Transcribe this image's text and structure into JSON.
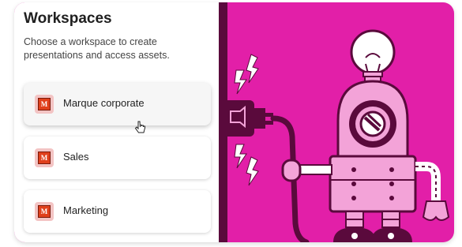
{
  "panel": {
    "title": "Workspaces",
    "subtitle": "Choose a workspace to create presentations and access assets."
  },
  "workspaces": [
    {
      "name": "Marque corporate",
      "logo_letter": "M",
      "selected": true
    },
    {
      "name": "Sales",
      "logo_letter": "M",
      "selected": false
    },
    {
      "name": "Marketing",
      "logo_letter": "M",
      "selected": false
    }
  ],
  "colors": {
    "accent_magenta": "#e21fa8",
    "robot_pink": "#f3a3d8",
    "outline_dark": "#5a0a3c",
    "logo_red": "#e0401c"
  },
  "icons": {
    "cursor": "hand-pointer-icon",
    "logo": "workspace-logo-icon"
  }
}
